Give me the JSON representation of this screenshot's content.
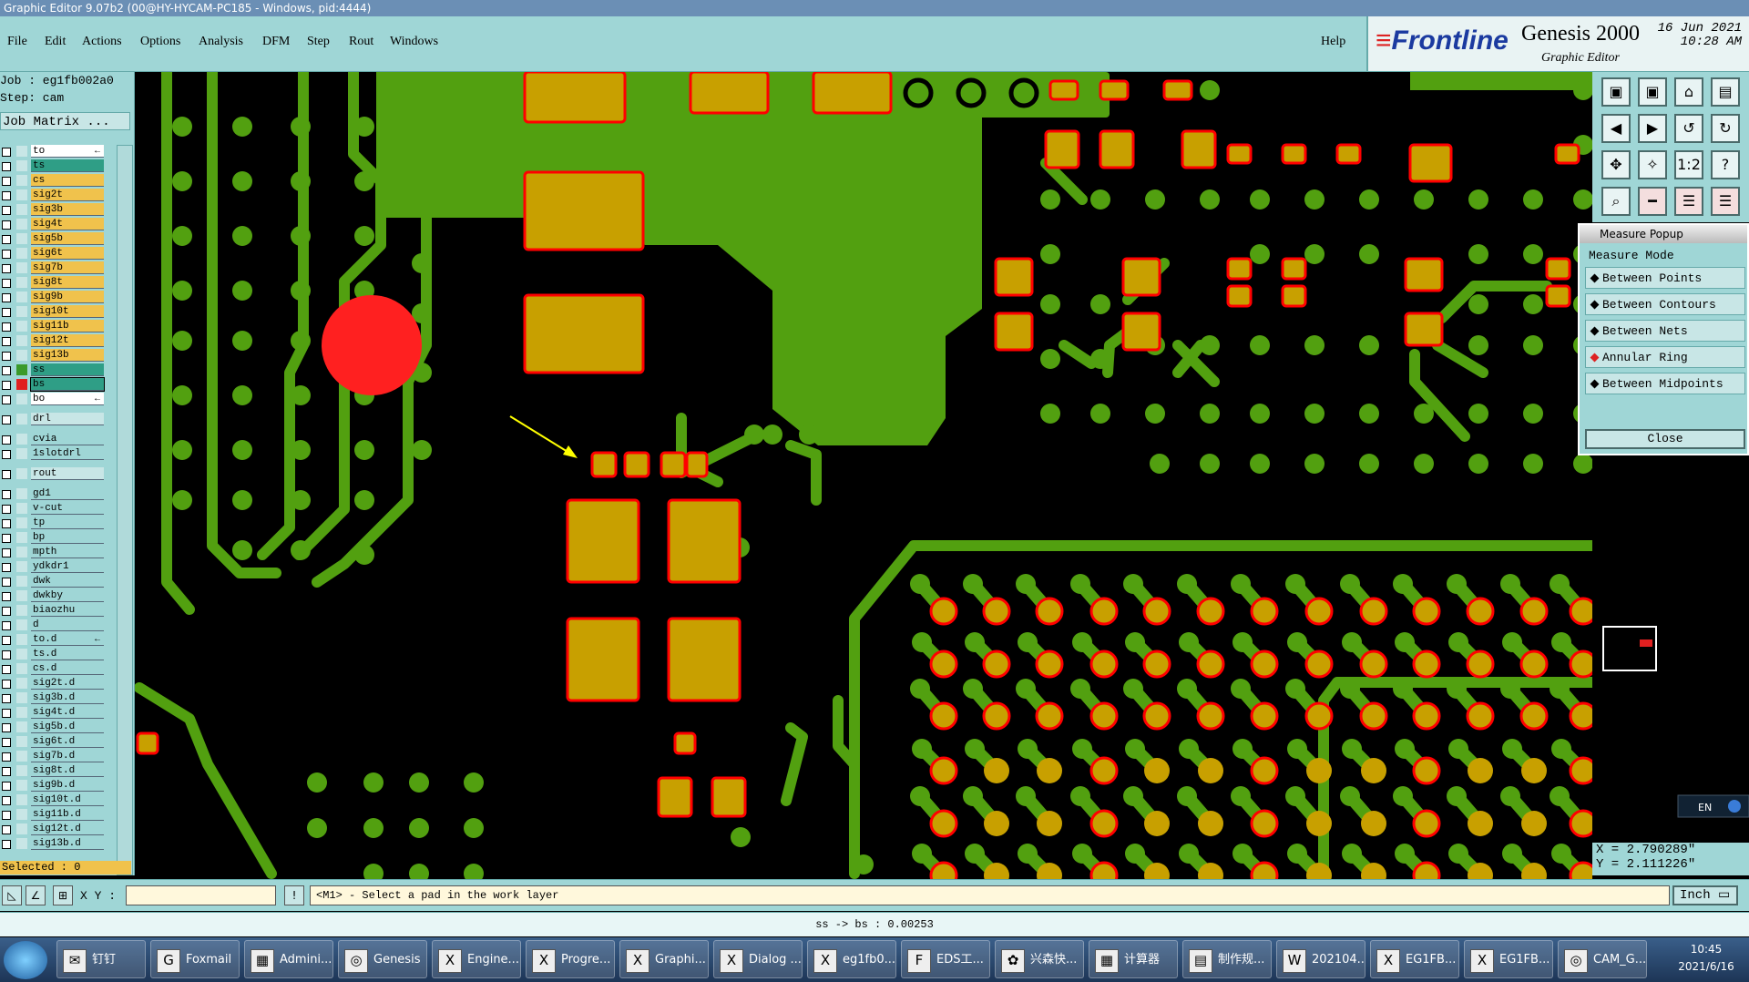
{
  "window": {
    "title": "Graphic Editor 9.07b2 (00@HY-HYCAM-PC185 - Windows, pid:4444)"
  },
  "menu": [
    "File",
    "Edit",
    "Actions",
    "Options",
    "Analysis",
    "DFM",
    "Step",
    "Rout",
    "Windows"
  ],
  "help_label": "Help",
  "brand": {
    "logo_text": "Frontline",
    "product": "Genesis 2000",
    "subtitle": "Graphic Editor",
    "date": "16 Jun 2021",
    "time": "10:28 AM"
  },
  "job": {
    "job_label": "Job : eg1fb002a0",
    "step_label": "Step: cam",
    "matrix_button": "Job Matrix ..."
  },
  "layers": [
    {
      "name": "to",
      "color": "#ffffff",
      "suffix": "←"
    },
    {
      "name": "ts",
      "color": "#2f9e86"
    },
    {
      "name": "cs",
      "color": "#f0c24c"
    },
    {
      "name": "sig2t",
      "color": "#f0c24c"
    },
    {
      "name": "sig3b",
      "color": "#f0c24c"
    },
    {
      "name": "sig4t",
      "color": "#f0c24c"
    },
    {
      "name": "sig5b",
      "color": "#f0c24c"
    },
    {
      "name": "sig6t",
      "color": "#f0c24c"
    },
    {
      "name": "sig7b",
      "color": "#f0c24c"
    },
    {
      "name": "sig8t",
      "color": "#f0c24c"
    },
    {
      "name": "sig9b",
      "color": "#f0c24c"
    },
    {
      "name": "sig10t",
      "color": "#f0c24c"
    },
    {
      "name": "sig11b",
      "color": "#f0c24c"
    },
    {
      "name": "sig12t",
      "color": "#f0c24c"
    },
    {
      "name": "sig13b",
      "color": "#f0c24c"
    },
    {
      "name": "ss",
      "color": "#2f9e86",
      "swatch": "#3a9a2a"
    },
    {
      "name": "bs",
      "color": "#2f9e86",
      "swatch": "#e02020",
      "active": true
    },
    {
      "name": "bo",
      "color": "#ffffff",
      "suffix": "←"
    },
    {
      "name": "drl",
      "color": "#c8e6e6",
      "gap": true
    },
    {
      "name": "cvia",
      "color": "#9fd6d6",
      "gap": true
    },
    {
      "name": "1slotdrl",
      "color": "#9fd6d6"
    },
    {
      "name": "rout",
      "color": "#c8e6e6",
      "gap": true
    },
    {
      "name": "gd1",
      "color": "#9fd6d6",
      "gap": true
    },
    {
      "name": "v-cut",
      "color": "#9fd6d6"
    },
    {
      "name": "tp",
      "color": "#9fd6d6"
    },
    {
      "name": "bp",
      "color": "#9fd6d6"
    },
    {
      "name": "mpth",
      "color": "#9fd6d6"
    },
    {
      "name": "ydkdr1",
      "color": "#9fd6d6"
    },
    {
      "name": "dwk",
      "color": "#9fd6d6"
    },
    {
      "name": "dwkby",
      "color": "#9fd6d6"
    },
    {
      "name": "biaozhu",
      "color": "#9fd6d6"
    },
    {
      "name": "d",
      "color": "#9fd6d6"
    },
    {
      "name": "to.d",
      "color": "#9fd6d6",
      "suffix": "←"
    },
    {
      "name": "ts.d",
      "color": "#9fd6d6"
    },
    {
      "name": "cs.d",
      "color": "#9fd6d6"
    },
    {
      "name": "sig2t.d",
      "color": "#9fd6d6"
    },
    {
      "name": "sig3b.d",
      "color": "#9fd6d6"
    },
    {
      "name": "sig4t.d",
      "color": "#9fd6d6"
    },
    {
      "name": "sig5b.d",
      "color": "#9fd6d6"
    },
    {
      "name": "sig6t.d",
      "color": "#9fd6d6"
    },
    {
      "name": "sig7b.d",
      "color": "#9fd6d6"
    },
    {
      "name": "sig8t.d",
      "color": "#9fd6d6"
    },
    {
      "name": "sig9b.d",
      "color": "#9fd6d6"
    },
    {
      "name": "sig10t.d",
      "color": "#9fd6d6"
    },
    {
      "name": "sig11b.d",
      "color": "#9fd6d6"
    },
    {
      "name": "sig12t.d",
      "color": "#9fd6d6"
    },
    {
      "name": "sig13b.d",
      "color": "#9fd6d6"
    }
  ],
  "selected_label": "Selected : 0",
  "toolbox_icons": [
    "top-icon",
    "bottom-icon",
    "home-icon",
    "panel-icon",
    "left-icon",
    "right-icon",
    "zoom-back-icon",
    "redraw-icon",
    "fit-icon",
    "pan-icon",
    "scale-1-2-icon",
    "help-icon",
    "snap-icon",
    "measure-icon",
    "net-icon",
    "highlight-icon"
  ],
  "toolbox_glyphs": [
    "▣",
    "▣",
    "⌂",
    "▤",
    "◀",
    "▶",
    "↺",
    "↻",
    "✥",
    "✧",
    "1:2",
    "?",
    "⌕",
    "━",
    "☰",
    "☰"
  ],
  "measure": {
    "title": "Measure Popup",
    "mode_label": "Measure Mode",
    "options": [
      "Between Points",
      "Between Contours",
      "Between Nets",
      "Annular Ring",
      "Between Midpoints"
    ],
    "selected_option": "Annular Ring",
    "close_label": "Close"
  },
  "coords": {
    "x": "X = 2.790289\"",
    "y": "Y = 2.111226\""
  },
  "language_indicator": "EN",
  "command": {
    "xy_label": "X Y :",
    "xy_value": "",
    "prompt": "<M1> - Select a pad in the work layer",
    "unit": "Inch"
  },
  "status": "ss -> bs : 0.00253",
  "taskbar": {
    "items": [
      {
        "label": "钉钉",
        "icon": "✉"
      },
      {
        "label": "Foxmail",
        "icon": "G"
      },
      {
        "label": "Admini...",
        "icon": "▦"
      },
      {
        "label": "Genesis",
        "icon": "◎"
      },
      {
        "label": "Engine...",
        "icon": "X"
      },
      {
        "label": "Progre...",
        "icon": "X"
      },
      {
        "label": "Graphi...",
        "icon": "X"
      },
      {
        "label": "Dialog ...",
        "icon": "X"
      },
      {
        "label": "eg1fb0...",
        "icon": "X"
      },
      {
        "label": "EDS工...",
        "icon": "F"
      },
      {
        "label": "兴森快...",
        "icon": "✿"
      },
      {
        "label": "计算器",
        "icon": "▦"
      },
      {
        "label": "制作规...",
        "icon": "▤"
      },
      {
        "label": "202104...",
        "icon": "W"
      },
      {
        "label": "EG1FB...",
        "icon": "X"
      },
      {
        "label": "EG1FB...",
        "icon": "X"
      },
      {
        "label": "CAM_G...",
        "icon": "◎"
      }
    ],
    "time": "10:45",
    "date": "2021/6/16"
  },
  "colors": {
    "pad_fill": "#c8a000",
    "pad_outline": "#ff0000",
    "trace": "#52a010",
    "background": "#000000"
  }
}
